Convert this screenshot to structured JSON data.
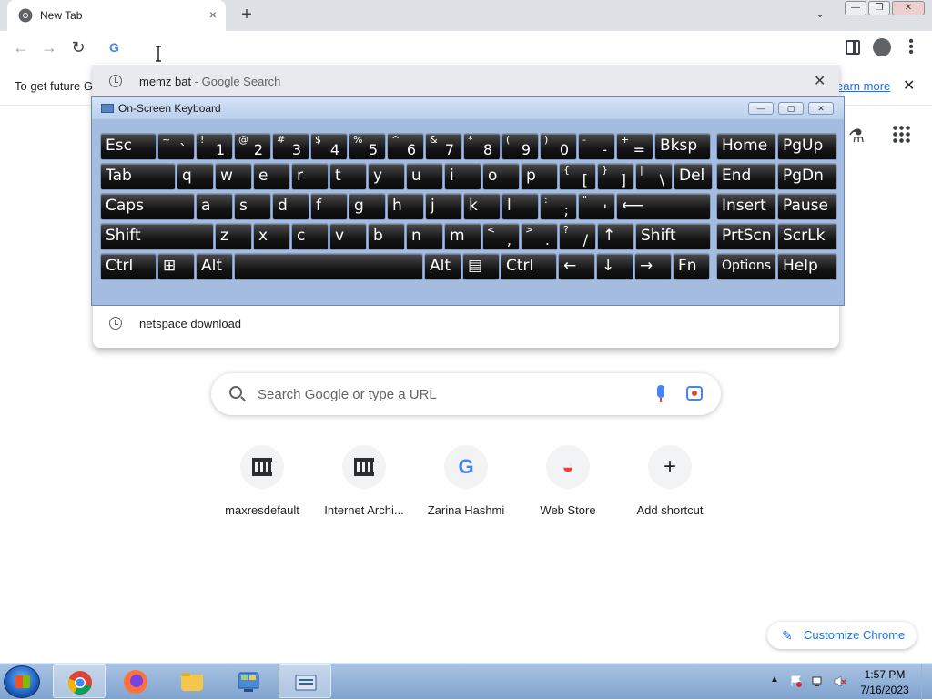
{
  "browser": {
    "tab_title": "New Tab",
    "tab_close": "×",
    "new_tab": "+",
    "tab_search": "⌄",
    "window_buttons": [
      "—",
      "❐",
      "✕"
    ],
    "omnibox_g": "G"
  },
  "infobar": {
    "message": "To get future G",
    "link": "earn more",
    "close": "✕"
  },
  "dropdown": {
    "suggestions": [
      {
        "text": "memz bat",
        "sub": " - Google Search",
        "remove": "✕"
      },
      {
        "text": "netspace download",
        "sub": ""
      }
    ]
  },
  "osk": {
    "title": "On-Screen Keyboard",
    "buttons": [
      "—",
      "▢",
      "✕"
    ],
    "rows": [
      [
        {
          "id": "esc",
          "lbl": "Esc"
        },
        {
          "id": "tilde",
          "sec": "~",
          "pri": "`"
        },
        {
          "id": "k1",
          "sec": "!",
          "pri": "1"
        },
        {
          "id": "k2",
          "sec": "@",
          "pri": "2"
        },
        {
          "id": "k3",
          "sec": "#",
          "pri": "3"
        },
        {
          "id": "k4",
          "sec": "$",
          "pri": "4"
        },
        {
          "id": "k5",
          "sec": "%",
          "pri": "5"
        },
        {
          "id": "k6",
          "sec": "^",
          "pri": "6"
        },
        {
          "id": "k7",
          "sec": "&",
          "pri": "7"
        },
        {
          "id": "k8",
          "sec": "*",
          "pri": "8"
        },
        {
          "id": "k9",
          "sec": "(",
          "pri": "9"
        },
        {
          "id": "k0",
          "sec": ")",
          "pri": "0"
        },
        {
          "id": "minus",
          "sec": "-",
          "pri": "-"
        },
        {
          "id": "equals",
          "sec": "+",
          "pri": "="
        },
        {
          "id": "bksp",
          "lbl": "Bksp"
        },
        {
          "id": "home",
          "lbl": "Home"
        },
        {
          "id": "pgup",
          "lbl": "PgUp"
        }
      ],
      [
        {
          "id": "tab",
          "lbl": "Tab"
        },
        {
          "id": "q",
          "lbl": "q"
        },
        {
          "id": "w",
          "lbl": "w"
        },
        {
          "id": "e",
          "lbl": "e"
        },
        {
          "id": "r",
          "lbl": "r"
        },
        {
          "id": "t",
          "lbl": "t"
        },
        {
          "id": "y",
          "lbl": "y"
        },
        {
          "id": "u",
          "lbl": "u"
        },
        {
          "id": "i",
          "lbl": "i"
        },
        {
          "id": "o",
          "lbl": "o"
        },
        {
          "id": "p",
          "lbl": "p"
        },
        {
          "id": "lbracket",
          "sec": "{",
          "pri": "["
        },
        {
          "id": "rbracket",
          "sec": "}",
          "pri": "]"
        },
        {
          "id": "backslash",
          "sec": "|",
          "pri": "\\"
        },
        {
          "id": "del",
          "lbl": "Del"
        },
        {
          "id": "end",
          "lbl": "End"
        },
        {
          "id": "pgdn",
          "lbl": "PgDn"
        }
      ],
      [
        {
          "id": "caps",
          "lbl": "Caps"
        },
        {
          "id": "a",
          "lbl": "a"
        },
        {
          "id": "s",
          "lbl": "s"
        },
        {
          "id": "d",
          "lbl": "d"
        },
        {
          "id": "f",
          "lbl": "f"
        },
        {
          "id": "g",
          "lbl": "g"
        },
        {
          "id": "h",
          "lbl": "h"
        },
        {
          "id": "j",
          "lbl": "j"
        },
        {
          "id": "k",
          "lbl": "k"
        },
        {
          "id": "l",
          "lbl": "l"
        },
        {
          "id": "semicolon",
          "sec": ":",
          "pri": ";"
        },
        {
          "id": "quote",
          "sec": "\"",
          "pri": "'"
        },
        {
          "id": "enter",
          "lbl": "⟵"
        },
        {
          "id": "insert",
          "lbl": "Insert"
        },
        {
          "id": "pause",
          "lbl": "Pause"
        }
      ],
      [
        {
          "id": "lshift",
          "lbl": "Shift"
        },
        {
          "id": "z",
          "lbl": "z"
        },
        {
          "id": "x",
          "lbl": "x"
        },
        {
          "id": "c",
          "lbl": "c"
        },
        {
          "id": "v",
          "lbl": "v"
        },
        {
          "id": "b",
          "lbl": "b"
        },
        {
          "id": "n",
          "lbl": "n"
        },
        {
          "id": "m",
          "lbl": "m"
        },
        {
          "id": "comma",
          "sec": "<",
          "pri": ","
        },
        {
          "id": "period",
          "sec": ">",
          "pri": "."
        },
        {
          "id": "slash",
          "sec": "?",
          "pri": "/"
        },
        {
          "id": "up",
          "lbl": "↑"
        },
        {
          "id": "rshift",
          "lbl": "Shift"
        },
        {
          "id": "prtscn",
          "lbl": "PrtScn"
        },
        {
          "id": "scrlk",
          "lbl": "ScrLk"
        }
      ],
      [
        {
          "id": "lctrl",
          "lbl": "Ctrl"
        },
        {
          "id": "win",
          "lbl": "⊞"
        },
        {
          "id": "lalt",
          "lbl": "Alt"
        },
        {
          "id": "space",
          "lbl": ""
        },
        {
          "id": "ralt",
          "lbl": "Alt"
        },
        {
          "id": "menu",
          "lbl": "▤"
        },
        {
          "id": "rctrl",
          "lbl": "Ctrl"
        },
        {
          "id": "left",
          "lbl": "←"
        },
        {
          "id": "down",
          "lbl": "↓"
        },
        {
          "id": "right",
          "lbl": "→"
        },
        {
          "id": "fn",
          "lbl": "Fn"
        },
        {
          "id": "options",
          "lbl": "Options"
        },
        {
          "id": "help",
          "lbl": "Help"
        }
      ]
    ]
  },
  "ntp": {
    "search_placeholder": "Search Google or type a URL",
    "shortcuts": [
      {
        "name": "maxresdefault",
        "icon": "archive-icon"
      },
      {
        "name": "Internet Archi...",
        "icon": "archive-icon"
      },
      {
        "name": "Zarina Hashmi",
        "icon": "google-g-icon",
        "glyph": "G"
      },
      {
        "name": "Web Store",
        "icon": "webstore-icon",
        "glyph": "◒"
      },
      {
        "name": "Add shortcut",
        "icon": "plus-icon",
        "glyph": "+"
      }
    ],
    "customize": "Customize Chrome",
    "customize_icon": "✎"
  },
  "taskbar": {
    "time": "1:57 PM",
    "date": "7/16/2023",
    "tray_arrow": "▲"
  },
  "colors": {
    "chrome_blue": "#1a73e8",
    "taskbar": "#8fb0d9"
  }
}
